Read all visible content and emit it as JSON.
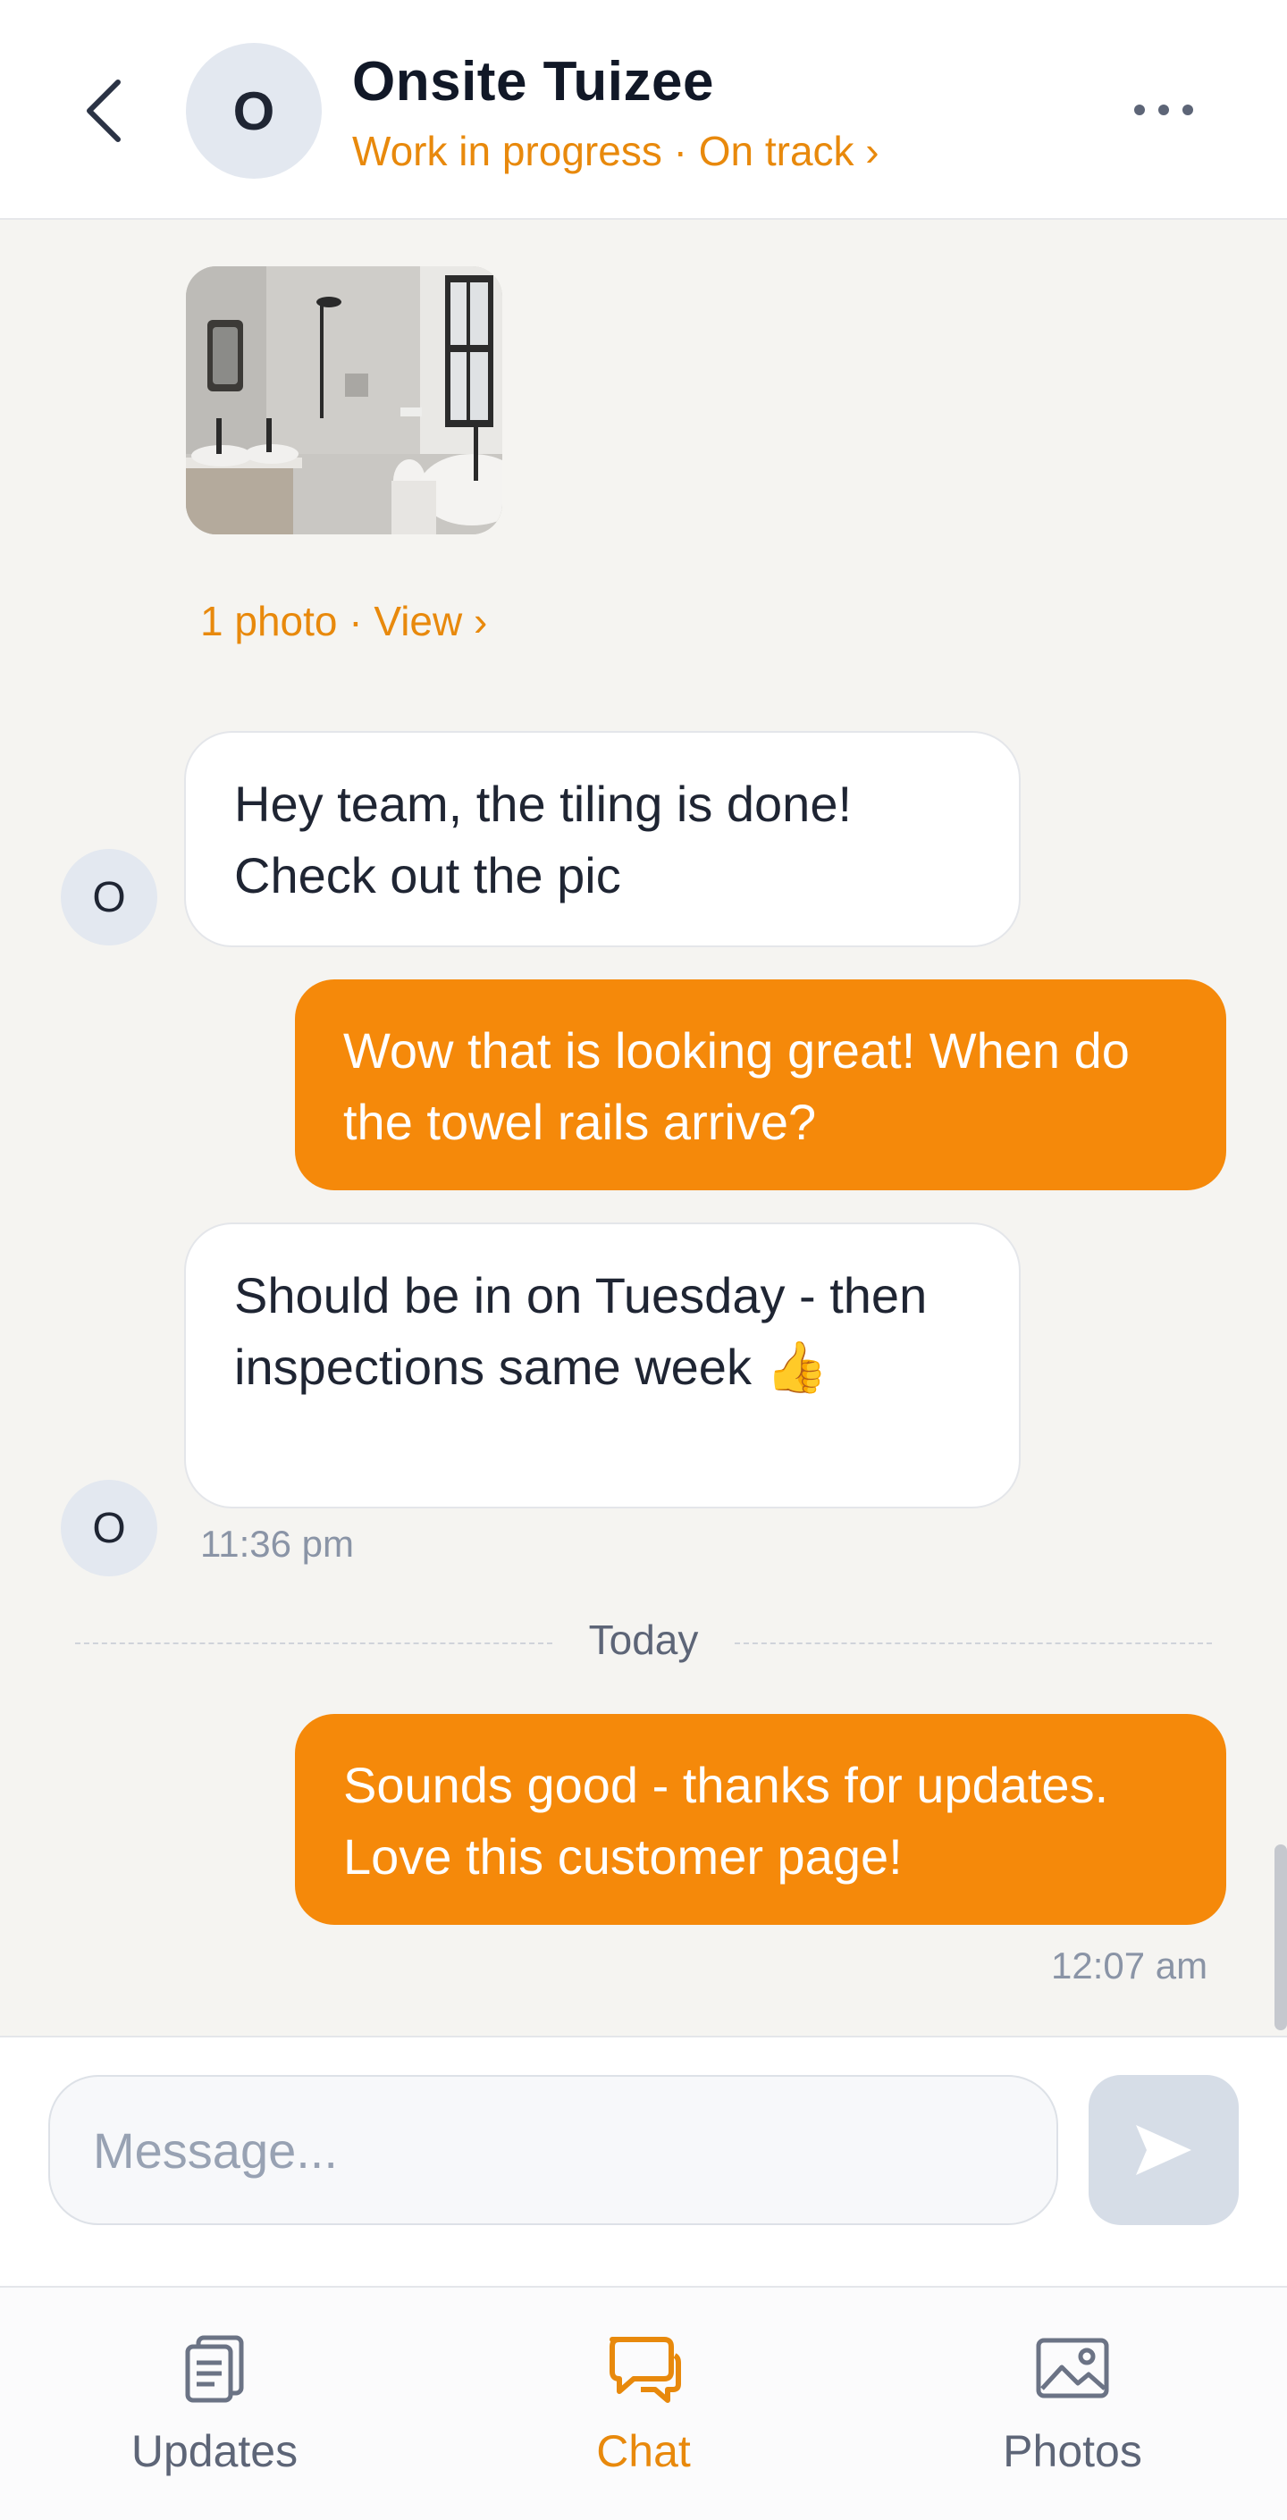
{
  "header": {
    "avatar_initial": "O",
    "title": "Onsite Tuizee",
    "status": "Work in progress · On track ›"
  },
  "chat": {
    "photo_caption": "1 photo · View ›",
    "messages": [
      {
        "direction": "in",
        "avatar_initial": "O",
        "text": "Hey team, the tiling is done! Check out the pic"
      },
      {
        "direction": "out",
        "text": "Wow that is looking great! When do the towel rails arrive?"
      },
      {
        "direction": "in",
        "avatar_initial": "O",
        "text": "Should be in on Tuesday - then inspections same week 👍",
        "time": "11:36 pm"
      },
      {
        "direction": "out",
        "text": "Sounds good - thanks for updates. Love this customer page!",
        "time": "12:07 am"
      }
    ],
    "day_divider": "Today"
  },
  "composer": {
    "placeholder": "Message...",
    "value": ""
  },
  "nav": {
    "items": [
      {
        "label": "Updates",
        "icon": "clipboard-icon",
        "active": false
      },
      {
        "label": "Chat",
        "icon": "chat-bubbles-icon",
        "active": true
      },
      {
        "label": "Photos",
        "icon": "image-icon",
        "active": false
      }
    ]
  },
  "colors": {
    "accent": "#f5890a",
    "accent_text": "#e8890c",
    "background": "#f5f4f1",
    "muted": "#8a94a6"
  }
}
